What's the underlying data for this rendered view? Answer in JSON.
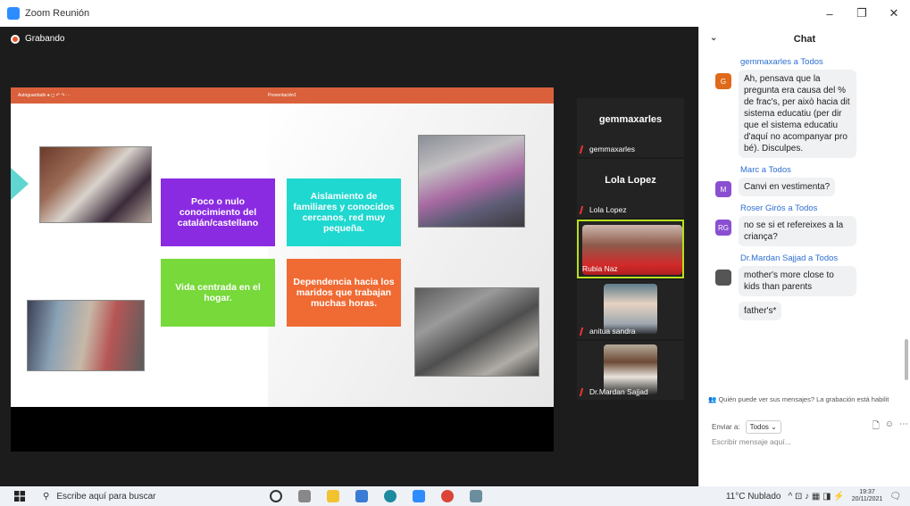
{
  "window": {
    "title": "Zoom Reunión",
    "minimize": "–",
    "maximize": "❐",
    "close": "✕"
  },
  "recording": {
    "label": "Grabando"
  },
  "slide": {
    "toolbar_autosave": "Autoguardado ● ◻ ↶ ↷ ⋯",
    "toolbar_title": "Presentación1",
    "boxes": [
      "Poco o nulo conocimiento del catalán/castellano",
      "Aislamiento de familiares y conocidos cercanos, red muy pequeña.",
      "Vida centrada en el hogar.",
      "Dependencia hacia los maridos que trabajan muchas horas."
    ]
  },
  "participants": [
    {
      "big": "gemmaxarles",
      "small": "gemmaxarles"
    },
    {
      "big": "Lola Lopez",
      "small": "Lola Lopez"
    },
    {
      "small": "Rubia Naz"
    },
    {
      "small": "anitua sandra"
    },
    {
      "small": "Dr.Mardan Sajjad"
    }
  ],
  "chat": {
    "title": "Chat",
    "messages": [
      {
        "from": "gemmaxarles a Todos",
        "avatar": "G",
        "color": "#e06a1b",
        "text": [
          "Ah, pensava que la pregunta era causa del % de frac's, per això hacia dit sistema educatiu (per dir que el sistema educatiu d'aquí no acompanyar pro bé). Disculpes."
        ]
      },
      {
        "from": "Marc a Todos",
        "avatar": "M",
        "color": "#8a4fd1",
        "text": [
          "Canvi en vestimenta?"
        ]
      },
      {
        "from": "Roser Girós a Todos",
        "avatar": "RG",
        "color": "#8a4fd1",
        "text": [
          "no se si et refereixes a la criança?"
        ]
      },
      {
        "from": "Dr.Mardan Sajjad a Todos",
        "avatar": "",
        "color": "#555555",
        "text": [
          "mother's more close to kids than parents",
          "father's*"
        ]
      }
    ],
    "notice": "Quién puede ver sus mensajes? La grabación está habilit",
    "send_to_label": "Enviar a:",
    "send_to_value": "Todos ⌄",
    "input_placeholder": "Escribir mensaje aquí..."
  },
  "taskbar": {
    "search": "Escribe aquí para buscar",
    "weather": "11°C Nublado",
    "time": "19:37",
    "date": "20/11/2021"
  }
}
